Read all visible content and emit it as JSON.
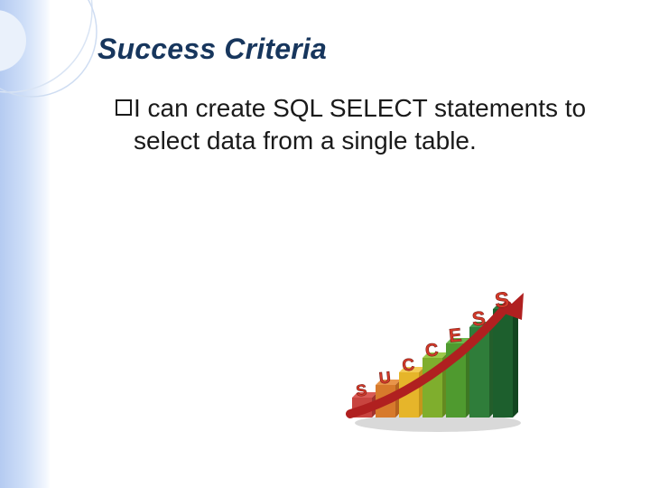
{
  "slide": {
    "title": "Success Criteria",
    "bullet_text": "I can create SQL SELECT statements to select data from a single table."
  },
  "graphic": {
    "word": "SUCCESS",
    "letters": [
      "S",
      "U",
      "C",
      "C",
      "E",
      "S",
      "S"
    ],
    "bar_colors": [
      "#c8443f",
      "#d77a2c",
      "#e6b52a",
      "#7fae2d",
      "#4f9a2f",
      "#2f7d3a",
      "#1d5f2d"
    ]
  }
}
